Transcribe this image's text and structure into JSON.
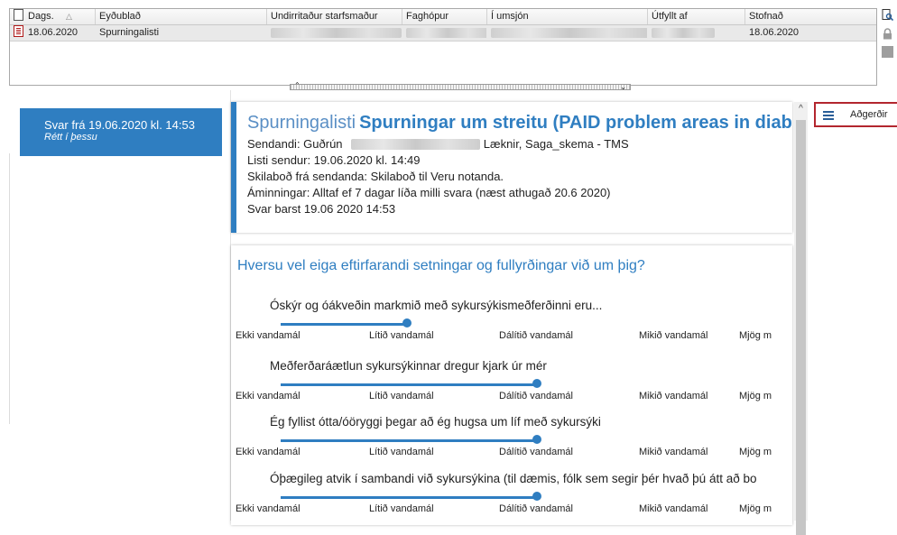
{
  "grid": {
    "columns": [
      "Dags.",
      "Eyðublað",
      "Undirritaður starfsmaður",
      "Faghópur",
      "Í umsjón",
      "Útfyllt af",
      "Stofnað"
    ],
    "rows": [
      {
        "date": "18.06.2020",
        "form": "Spurningalisti",
        "created": "18.06.2020"
      }
    ]
  },
  "answer": {
    "title": "Svar frá 19.06.2020 kl. 14:53",
    "subtitle": "Rétt í þessu"
  },
  "info": {
    "type": "Spurningalisti",
    "name": "Spurningar um streitu (PAID problem areas in diab",
    "sender_label": "Sendandi: Guðrún",
    "sender_role": "Læknir, Saga_skema - TMS",
    "sent": "Listi sendur: 19.06.2020 kl. 14:49",
    "message": "Skilaboð frá sendanda:  Skilaboð til Veru notanda.",
    "reminder": "Áminningar: Alltaf ef 7 dagar líða milli svara (næst athugað 20.6 2020)",
    "answered": "Svar barst 19.06 2020 14:53"
  },
  "questions": {
    "heading": "Hversu vel eiga eftirfarandi setningar og fullyrðingar við um þig?",
    "scale": [
      "Ekki vandamál",
      "Lítið vandamál",
      "Dálítið vandamál",
      "Mikið vandamál",
      "Mjög m"
    ],
    "items": [
      {
        "text": "Óskýr og óákveðin markmið með sykursýkismeðferðinni eru...",
        "value_index": 1
      },
      {
        "text": "Meðferðaráætlun sykursýkinnar dregur kjark úr mér",
        "value_index": 2
      },
      {
        "text": "Ég fyllist ótta/óöryggi þegar að ég hugsa um líf með sykursýki",
        "value_index": 2
      },
      {
        "text": "Óþægileg atvik í sambandi við sykursýkina (til dæmis, fólk sem segir þér hvað þú átt að bo",
        "value_index": 2
      }
    ]
  },
  "actions": {
    "label": "Aðgerðir"
  },
  "icons": {
    "sort": "sort-triangle-icon",
    "doc": "document-icon",
    "form": "form-red-icon",
    "menu": "hamburger-icon"
  },
  "colors": {
    "accent": "#2f7ec1",
    "actions_border": "#b3262e"
  }
}
